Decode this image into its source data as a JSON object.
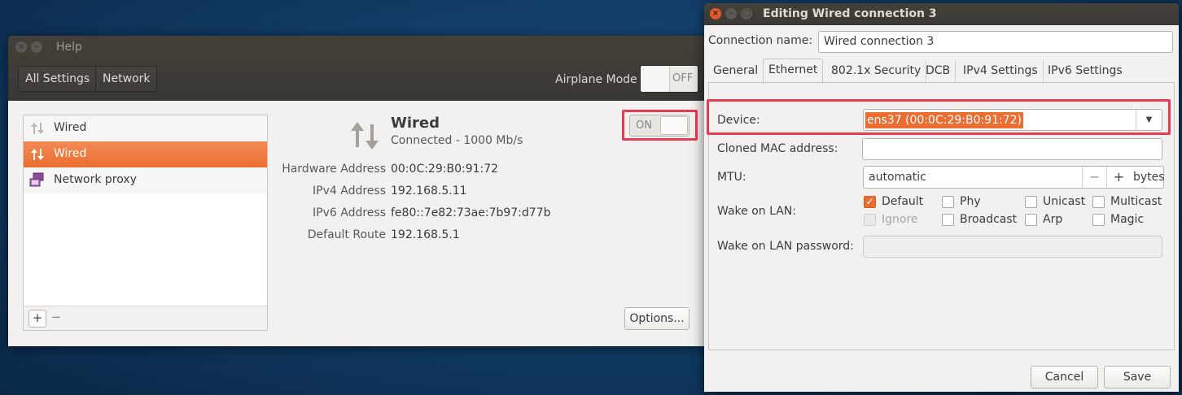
{
  "settings": {
    "title": "Help",
    "header_buttons": {
      "all_settings": "All Settings",
      "network": "Network"
    },
    "airplane": {
      "label": "Airplane Mode",
      "state": "OFF"
    },
    "devices": [
      {
        "label": "Wired",
        "icon": "network-arrows-icon",
        "selected": false
      },
      {
        "label": "Wired",
        "icon": "network-arrows-icon",
        "selected": true
      },
      {
        "label": "Network proxy",
        "icon": "network-proxy-icon",
        "selected": false
      }
    ],
    "toolbar": {
      "add": "+",
      "remove": "−"
    },
    "detail": {
      "title": "Wired",
      "status": "Connected - 1000 Mb/s",
      "switch_state": "ON",
      "rows": [
        {
          "key": "Hardware Address",
          "value": "00:0C:29:B0:91:72"
        },
        {
          "key": "IPv4 Address",
          "value": "192.168.5.11"
        },
        {
          "key": "IPv6 Address",
          "value": "fe80::7e82:73ae:7b97:d77b"
        },
        {
          "key": "Default Route",
          "value": "192.168.5.1"
        }
      ],
      "options_button": "Options..."
    }
  },
  "editor": {
    "title": "Editing Wired connection 3",
    "connection_name_label": "Connection name:",
    "connection_name": "Wired connection 3",
    "tabs": [
      "General",
      "Ethernet",
      "802.1x Security",
      "DCB",
      "IPv4 Settings",
      "IPv6 Settings"
    ],
    "active_tab": "Ethernet",
    "device_label": "Device:",
    "device_value": "ens37 (00:0C:29:B0:91:72)",
    "cloned_mac_label": "Cloned MAC address:",
    "cloned_mac_value": "",
    "mtu_label": "MTU:",
    "mtu_value": "automatic",
    "mtu_minus": "−",
    "mtu_plus": "+",
    "mtu_unit": "bytes",
    "wol_label": "Wake on LAN:",
    "wol_options": [
      {
        "label": "Default",
        "checked": true,
        "disabled": false
      },
      {
        "label": "Phy",
        "checked": false,
        "disabled": false
      },
      {
        "label": "Unicast",
        "checked": false,
        "disabled": false
      },
      {
        "label": "Multicast",
        "checked": false,
        "disabled": false
      },
      {
        "label": "Ignore",
        "checked": false,
        "disabled": true
      },
      {
        "label": "Broadcast",
        "checked": false,
        "disabled": false
      },
      {
        "label": "Arp",
        "checked": false,
        "disabled": false
      },
      {
        "label": "Magic",
        "checked": false,
        "disabled": false
      }
    ],
    "wol_password_label": "Wake on LAN password:",
    "wol_password_value": "",
    "cancel_button": "Cancel",
    "save_button": "Save"
  },
  "colors": {
    "accent": "#ea6e31",
    "highlight": "#e83a52"
  }
}
